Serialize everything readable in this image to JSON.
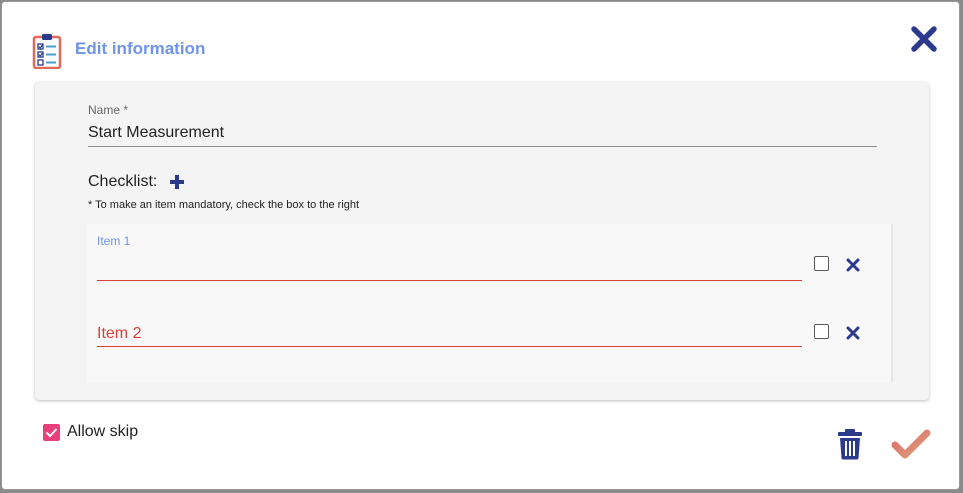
{
  "dialog": {
    "title": "Edit information",
    "title_icon": "clipboard-checklist-icon",
    "close_icon": "close-icon"
  },
  "form": {
    "name_label": "Name *",
    "name_value": "Start Measurement",
    "checklist_label": "Checklist:",
    "add_icon": "plus-icon",
    "hint": "* To make an item mandatory, check the box to the right",
    "items": [
      {
        "label": "Item 1",
        "value": "",
        "mandatory": false
      },
      {
        "placeholder": "Item 2",
        "value": "",
        "mandatory": false
      }
    ],
    "allow_skip_label": "Allow skip",
    "allow_skip_checked": true
  },
  "actions": {
    "delete_icon": "trash-icon",
    "confirm_icon": "checkmark-icon"
  },
  "colors": {
    "accent_blue": "#6f95e8",
    "navy": "#2b3a8c",
    "error_red": "#d9403a",
    "checkbox_pink": "#e8407a",
    "confirm_gradient": [
      "#e46a6a",
      "#d7a07a"
    ]
  }
}
